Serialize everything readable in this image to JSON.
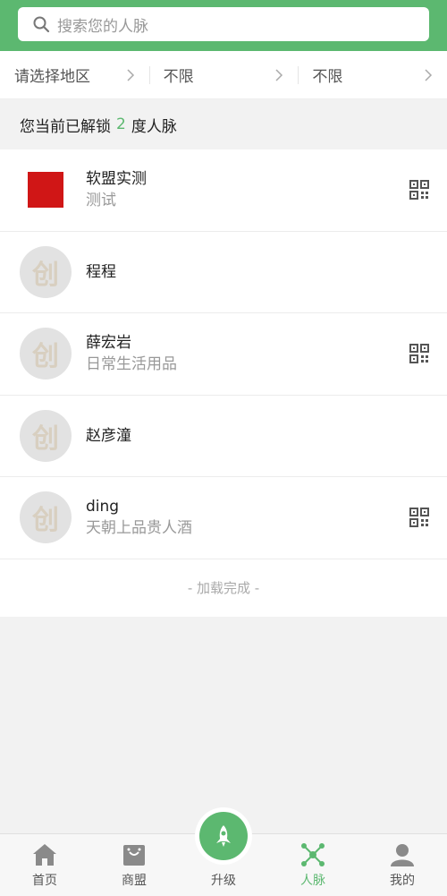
{
  "search": {
    "placeholder": "搜索您的人脉"
  },
  "filters": [
    {
      "label": "请选择地区"
    },
    {
      "label": "不限"
    },
    {
      "label": "不限"
    }
  ],
  "unlock": {
    "prefix": "您当前已解锁",
    "count": "2",
    "suffix": "度人脉"
  },
  "contacts": [
    {
      "name": "软盟实测",
      "subtitle": "测试",
      "avatar": "red-square",
      "qr": true
    },
    {
      "name": "程程",
      "subtitle": "",
      "avatar": "创",
      "qr": false
    },
    {
      "name": "薛宏岩",
      "subtitle": "日常生活用品",
      "avatar": "创",
      "qr": true
    },
    {
      "name": "赵彦潼",
      "subtitle": "",
      "avatar": "创",
      "qr": false
    },
    {
      "name": "ding",
      "subtitle": "天朝上品贵人酒",
      "avatar": "创",
      "qr": true
    }
  ],
  "load_status": "- 加载完成 -",
  "tabs": [
    {
      "label": "首页",
      "icon": "home-icon",
      "active": false
    },
    {
      "label": "商盟",
      "icon": "shop-icon",
      "active": false
    },
    {
      "label": "升级",
      "icon": "rocket-icon",
      "active": false
    },
    {
      "label": "人脉",
      "icon": "network-icon",
      "active": true
    },
    {
      "label": "我的",
      "icon": "user-icon",
      "active": false
    }
  ],
  "colors": {
    "accent": "#5cb870",
    "avatar_red": "#d01616"
  }
}
